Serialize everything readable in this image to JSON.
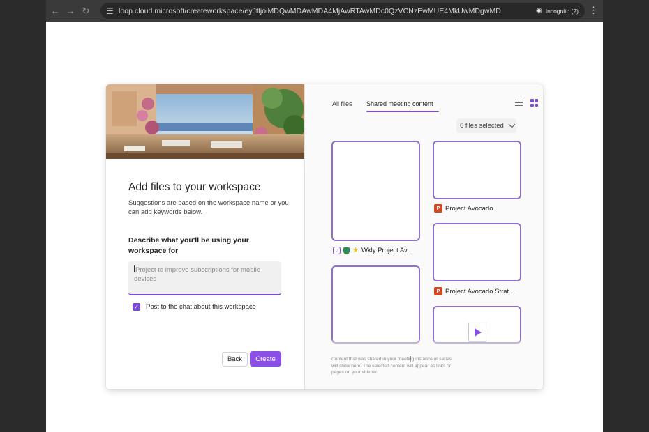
{
  "browser": {
    "url": "loop.cloud.microsoft/createworkspace/eyJtIjoiMDQwMDAwMDA4MjAwRTAwMDc0QzVCNzEwMUE4MkUwMDgwMDAwMDAwMDAwMDAwMDAwMDAwMDAw",
    "incognito_label": "Incognito (2)",
    "icons": [
      "back-arrow-icon",
      "forward-arrow-icon",
      "reload-icon",
      "site-settings-icon",
      "eye-off-icon",
      "star-icon",
      "incognito-icon",
      "more-icon"
    ]
  },
  "dialog": {
    "title": "Add files to your workspace",
    "subtitle": "Suggestions are based on the workspace name or you can add keywords below.",
    "describe_label": "Describe what you'll be using your workspace for",
    "textarea_placeholder": "Project to improve subscriptions for mobile devices",
    "checkbox_label": "Post to the chat about this workspace",
    "checkbox_checked": true,
    "back_label": "Back",
    "create_label": "Create"
  },
  "files_panel": {
    "tabs": [
      {
        "label": "All files",
        "active": false
      },
      {
        "label": "Shared meeting content",
        "active": true
      }
    ],
    "selection_label": "6 files selected",
    "files": [
      {
        "name": "Wkly Project Av...",
        "type": "loop"
      },
      {
        "name": "Project Avocado",
        "type": "powerpoint"
      },
      {
        "name": "Project Avocado Strat...",
        "type": "powerpoint"
      },
      {
        "name": "",
        "type": "document"
      },
      {
        "name": "",
        "type": "video"
      }
    ],
    "footnote": "Content that was shared in your meeting instance or series will show here. The selected content will appear as links or pages on your sidebar."
  },
  "colors": {
    "accent": "#7b4bd8",
    "create_button": "#8b4fe8",
    "card_border": "#8f6fcf",
    "powerpoint": "#d24726"
  }
}
